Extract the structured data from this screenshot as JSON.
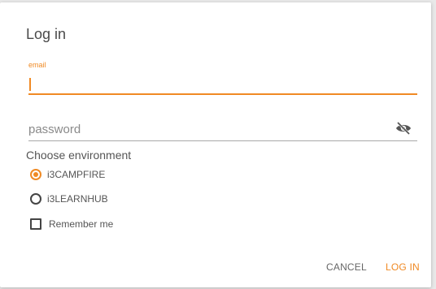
{
  "dialog": {
    "title": "Log in",
    "email": {
      "label": "email",
      "value": ""
    },
    "password": {
      "placeholder": "password",
      "value": "",
      "toggle_icon": "eye-off-icon"
    },
    "environment": {
      "label": "Choose environment",
      "options": [
        {
          "label": "i3CAMPFIRE",
          "selected": true
        },
        {
          "label": "i3LEARNHUB",
          "selected": false
        }
      ]
    },
    "remember": {
      "label": "Remember me",
      "checked": false
    },
    "actions": {
      "cancel_label": "CANCEL",
      "login_label": "LOG IN"
    }
  },
  "colors": {
    "accent": "#f08a24",
    "text": "#555555",
    "background": "#ffffff"
  }
}
